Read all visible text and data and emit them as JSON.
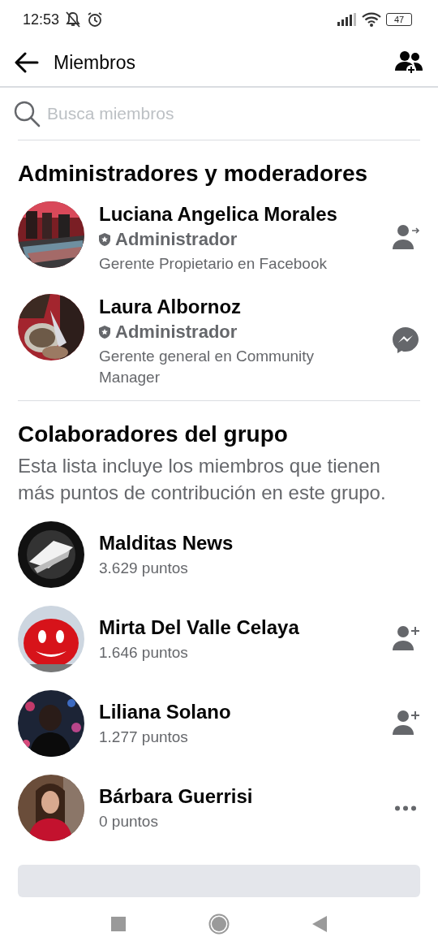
{
  "status_bar": {
    "time": "12:53",
    "battery": "47"
  },
  "header": {
    "title": "Miembros"
  },
  "search": {
    "placeholder": "Busca miembros"
  },
  "sections": [
    {
      "title": "Administradores y moderadores",
      "members": [
        {
          "name": "Luciana Angelica Morales",
          "role": "Administrador",
          "subtitle": "Gerente Propietario en Facebook",
          "action": {
            "kind": "follow"
          }
        },
        {
          "name": "Laura Albornoz",
          "role": "Administrador",
          "subtitle": "Gerente general en Community Manager",
          "action": {
            "kind": "message"
          }
        }
      ]
    },
    {
      "title": "Colaboradores del grupo",
      "description": "Esta lista incluye los miembros que tienen más puntos de contribución en este grupo.",
      "members": [
        {
          "name": "Malditas News",
          "subtitle": "3.629 puntos"
        },
        {
          "name": "Mirta Del Valle Celaya",
          "subtitle": "1.646 puntos",
          "action": {
            "kind": "add-friend"
          }
        },
        {
          "name": "Liliana Solano",
          "subtitle": "1.277 puntos",
          "action": {
            "kind": "add-friend"
          }
        },
        {
          "name": "Bárbara Guerrisi",
          "subtitle": "0 puntos",
          "action": {
            "kind": "more"
          }
        }
      ]
    }
  ]
}
